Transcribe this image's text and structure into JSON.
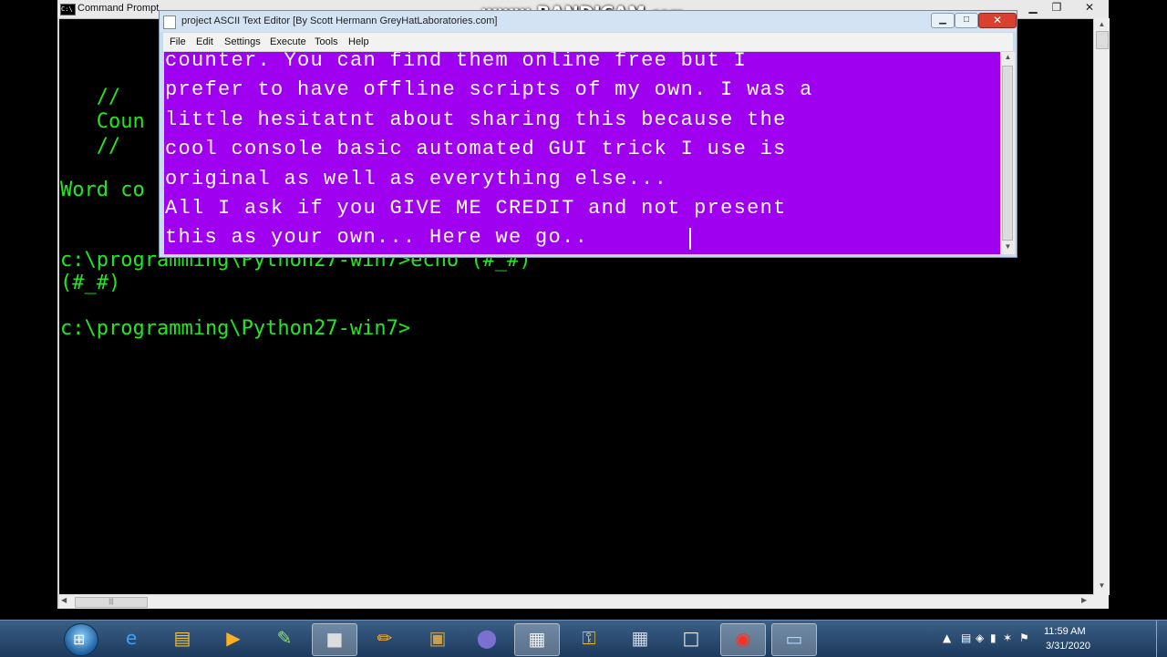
{
  "cmd": {
    "title": "Command Prompt",
    "lines": [
      "   //",
      "   Coun",
      "   //",
      "Word co",
      "c:\\programming\\Python27-win7>echo (#_#)",
      "(#_#)",
      "c:\\programming\\Python27-win7>"
    ]
  },
  "watermark": {
    "brand": "www.BANDICAM",
    "domain": ".com"
  },
  "editor": {
    "title": "project ASCII Text Editor [By Scott Hermann GreyHatLaboratories.com]",
    "menu": [
      "File",
      "Edit",
      "Settings",
      "Execute",
      "Tools",
      "Help"
    ],
    "lines": [
      "counter. You can find them online free but I",
      "prefer to have offline scripts of my own. I was a",
      "little hesitatnt about sharing this because the",
      "cool console basic automated GUI trick I use is",
      "original as well as everything else...",
      "All I ask if you GIVE ME CREDIT and not present",
      "this as your own... Here we go.."
    ],
    "text_bg": "#a000f0",
    "text_color": "#ffffff"
  },
  "taskbar": {
    "start_icon": "windows-start-orb",
    "items": [
      {
        "name": "internet-explorer-icon",
        "glyph": "e",
        "color": "#3aa0ff",
        "active": false
      },
      {
        "name": "file-explorer-icon",
        "glyph": "▤",
        "color": "#f0c040",
        "active": false
      },
      {
        "name": "media-player-icon",
        "glyph": "▶",
        "color": "#ffb020",
        "active": false
      },
      {
        "name": "notepad-icon",
        "glyph": "✎",
        "color": "#90e070",
        "active": false
      },
      {
        "name": "command-prompt-icon",
        "glyph": "■",
        "color": "#dddddd",
        "active": true
      },
      {
        "name": "pencil-tool-icon",
        "glyph": "✏",
        "color": "#ffb030",
        "active": false
      },
      {
        "name": "dosbox-icon",
        "glyph": "▣",
        "color": "#c9a050",
        "active": false
      },
      {
        "name": "molecule-app-icon",
        "glyph": "⬤",
        "color": "#7a70d0",
        "active": false
      },
      {
        "name": "text-editor-icon",
        "glyph": "▦",
        "color": "#f0f0f0",
        "active": true
      },
      {
        "name": "keys-icon",
        "glyph": "⚿",
        "color": "#f0c020",
        "active": false
      },
      {
        "name": "calculator-icon",
        "glyph": "▦",
        "color": "#cfd8e8",
        "active": false
      },
      {
        "name": "document-icon",
        "glyph": "□",
        "color": "#e8e8e8",
        "active": false
      },
      {
        "name": "bandicam-record-icon",
        "glyph": "◉",
        "color": "#ff3020",
        "active": true
      },
      {
        "name": "window-app-icon",
        "glyph": "▭",
        "color": "#a8d8ff",
        "active": true
      }
    ],
    "tray_icons": [
      "▲",
      "▤",
      "◈",
      "▮",
      "✶",
      "⚑"
    ],
    "time": "11:59 AM",
    "date": "3/31/2020"
  }
}
